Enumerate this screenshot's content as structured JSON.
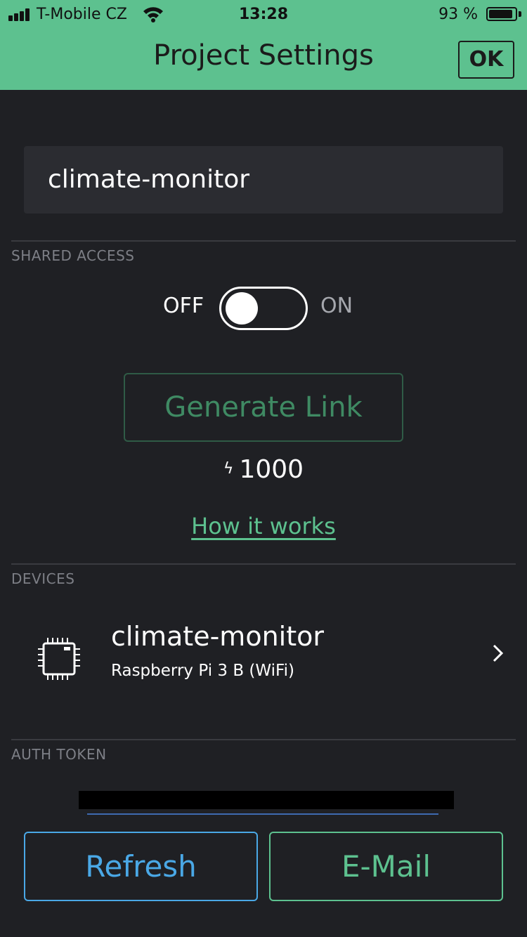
{
  "status_bar": {
    "carrier": "T-Mobile CZ",
    "time": "13:28",
    "battery_percent": "93 %",
    "battery_level": 0.93,
    "signal_icon": "signal-bars-icon",
    "wifi_icon": "wifi-icon",
    "battery_icon": "battery-icon"
  },
  "header": {
    "title": "Project Settings",
    "ok_label": "OK",
    "background_color": "#5dc18f"
  },
  "project": {
    "name": "climate-monitor"
  },
  "shared_access": {
    "section_label": "SHARED ACCESS",
    "toggle_off_label": "OFF",
    "toggle_on_label": "ON",
    "toggle_state": "off",
    "generate_link_label": "Generate Link",
    "energy_icon": "bolt-icon",
    "energy_symbol": "ϟ",
    "energy_value": "1000",
    "how_it_works_label": "How it works"
  },
  "devices": {
    "section_label": "DEVICES",
    "items": [
      {
        "name": "climate-monitor",
        "model": "Raspberry Pi 3 B (WiFi)",
        "icon": "chip-icon"
      }
    ]
  },
  "auth_token": {
    "section_label": "AUTH TOKEN"
  },
  "actions": {
    "refresh_label": "Refresh",
    "email_label": "E-Mail",
    "refresh_color": "#4aa8e6",
    "email_color": "#5dc18f"
  }
}
